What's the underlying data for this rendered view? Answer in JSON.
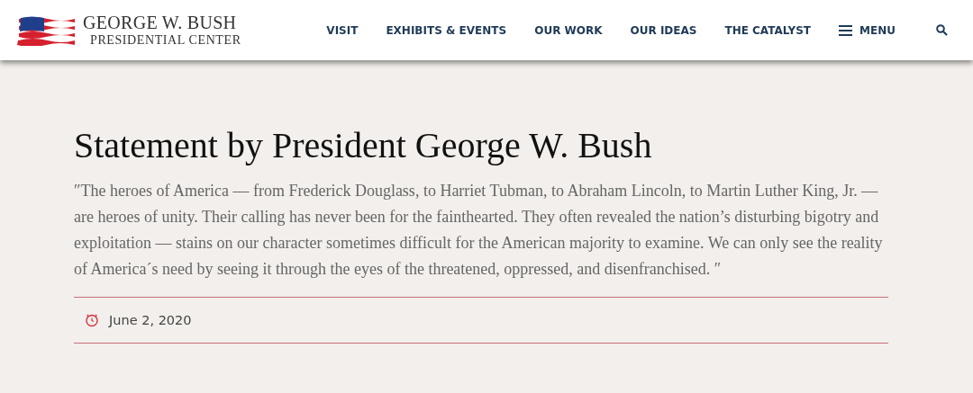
{
  "header": {
    "logo": {
      "line_1": "GEORGE W. BUSH",
      "line_2": "PRESIDENTIAL CENTER"
    },
    "nav": [
      {
        "label": "VISIT"
      },
      {
        "label": "EXHIBITS & EVENTS"
      },
      {
        "label": "OUR WORK"
      },
      {
        "label": "OUR IDEAS"
      },
      {
        "label": "THE CATALYST"
      }
    ],
    "menu_button": "MENU"
  },
  "article": {
    "title": "Statement by President George W. Bush",
    "quote": "″The heroes of America — from Frederick Douglass, to Harriet Tubman, to Abraham Lincoln, to Martin Luther King, Jr. — are heroes of unity. Their calling has never been for the fainthearted. They often revealed the nation’s disturbing bigotry and exploitation — stains on our character sometimes difficult for the American majority to examine. We can only see the reality of America´s need by seeing it through the eyes of the threatened, oppressed, and disenfranchised. ″",
    "date": "June 2, 2020"
  }
}
